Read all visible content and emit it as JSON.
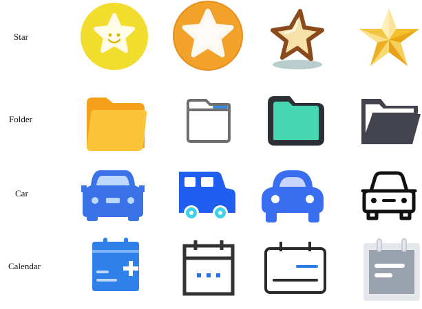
{
  "rows": [
    {
      "label": "Star",
      "icons": [
        "star-smiley-yellow-icon",
        "star-white-on-orange-icon",
        "star-cartoon-shadow-icon",
        "star-3d-gold-icon"
      ]
    },
    {
      "label": "Folder",
      "icons": [
        "folder-orange-icon",
        "folder-outline-gray-icon",
        "folder-teal-dark-icon",
        "folder-open-dark-icon"
      ]
    },
    {
      "label": "Car",
      "icons": [
        "car-front-blue-icon",
        "car-side-blue-icon",
        "car-front-blue-rounded-icon",
        "car-outline-black-icon"
      ]
    },
    {
      "label": "Calendar",
      "icons": [
        "calendar-add-blue-icon",
        "calendar-outline-dark-icon",
        "calendar-outline-blue-accent-icon",
        "calendar-notepad-gray-icon"
      ]
    }
  ]
}
